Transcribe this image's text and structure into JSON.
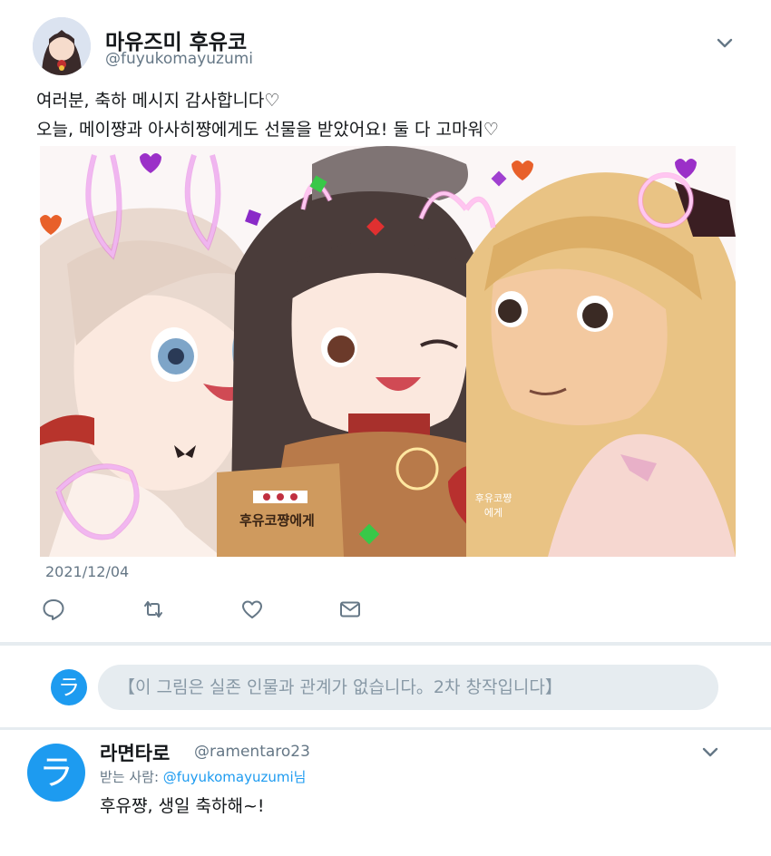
{
  "tweet": {
    "display_name": "마유즈미 후유코",
    "handle": "@fuyukomayuzumi",
    "text_line1": "여러분, 축하 메시지 감사합니다♡",
    "text_line2": "오늘, 메이쨩과 아사히쨩에게도 선물을 받았어요! 둘 다 고마워♡",
    "date": "2021/12/04",
    "image": {
      "gift_bag_text": "후유코쨩에게",
      "heart_tag_line1": "후유코쨩",
      "heart_tag_line2": "에게"
    },
    "actions": [
      "reply-icon",
      "retweet-icon",
      "like-icon",
      "dm-icon"
    ]
  },
  "reply_bar": {
    "avatar_letter": "ラ",
    "text": "【이 그림은 실존 인물과 관계가 없습니다。2차 창작입니다】"
  },
  "reply": {
    "avatar_letter": "ラ",
    "display_name": "라면타로",
    "handle": "@ramentaro23",
    "to_label": "받는 사람: ",
    "to_mention": "@fuyukomayuzumi님",
    "text": "후유쨩, 생일 축하해~!"
  },
  "colors": {
    "accent": "#1d9bf0",
    "divider": "#e6ecf0",
    "secondary_text": "#657786"
  }
}
